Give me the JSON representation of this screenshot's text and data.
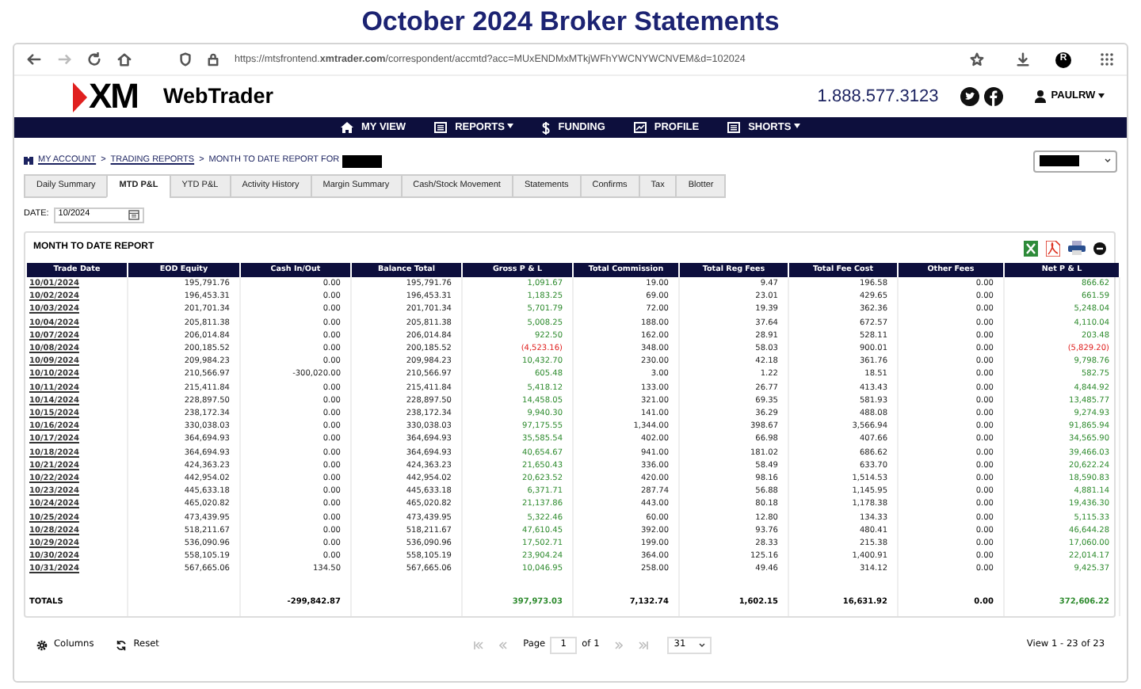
{
  "page_title": "October 2024 Broker Statements",
  "browser": {
    "url": "https://mtsfrontend.**xmtrader.com**/correspondent/accmtd?acc=MUxENDMxMTkjWFhYWCNYWCNVEM&d=102024",
    "profile_initial": "R"
  },
  "header": {
    "logo": "XM",
    "app_name": "WebTrader",
    "phone": "1.888.577.3123",
    "user": "PAULRW"
  },
  "nav": [
    {
      "label": "MY VIEW",
      "kind": "home",
      "has_menu": false
    },
    {
      "label": "REPORTS",
      "kind": "list",
      "has_menu": true
    },
    {
      "label": "FUNDING",
      "kind": "dollar",
      "has_menu": false
    },
    {
      "label": "PROFILE",
      "kind": "chart",
      "has_menu": false
    },
    {
      "label": "SHORTS",
      "kind": "list",
      "has_menu": true
    }
  ],
  "breadcrumb": [
    {
      "label": "MY ACCOUNT",
      "kind": "link"
    },
    {
      "label": ">",
      "kind": "separator"
    },
    {
      "label": "TRADING REPORTS",
      "kind": "link"
    },
    {
      "label": ">",
      "kind": "separator"
    },
    {
      "label": "MONTH TO DATE REPORT FOR",
      "kind": "text"
    }
  ],
  "tabs": [
    {
      "label": "Daily Summary",
      "selected": false
    },
    {
      "label": "MTD P&L",
      "selected": true
    },
    {
      "label": "YTD P&L",
      "selected": false
    },
    {
      "label": "Activity History",
      "selected": false
    },
    {
      "label": "Margin Summary",
      "selected": false
    },
    {
      "label": "Cash/Stock Movement",
      "selected": false
    },
    {
      "label": "Statements",
      "selected": false
    },
    {
      "label": "Confirms",
      "selected": false
    },
    {
      "label": "Tax",
      "selected": false
    },
    {
      "label": "Blotter",
      "selected": false
    }
  ],
  "date_field": {
    "label": "DATE:",
    "value": "10/2024"
  },
  "report": {
    "title": "MONTH TO DATE REPORT",
    "columns": [
      "Trade Date",
      "EOD Equity",
      "Cash In/Out",
      "Balance Total",
      "Gross P & L",
      "Total Commission",
      "Total Reg Fees",
      "Total Fee Cost",
      "Other Fees",
      "Net P & L"
    ],
    "rows": [
      {
        "date": "10/01/2024",
        "eod": "195,791.76",
        "cash": "0.00",
        "balance": "195,791.76",
        "gross": {
          "text": "1,091.67",
          "loss": false
        },
        "commission": "19.00",
        "reg": "9.47",
        "fee": "196.58",
        "other": "0.00",
        "net": {
          "text": "866.62",
          "loss": false
        }
      },
      {
        "date": "10/02/2024",
        "eod": "196,453.31",
        "cash": "0.00",
        "balance": "196,453.31",
        "gross": {
          "text": "1,183.25",
          "loss": false
        },
        "commission": "69.00",
        "reg": "23.01",
        "fee": "429.65",
        "other": "0.00",
        "net": {
          "text": "661.59",
          "loss": false
        }
      },
      {
        "date": "10/03/2024",
        "eod": "201,701.34",
        "cash": "0.00",
        "balance": "201,701.34",
        "gross": {
          "text": "5,701.79",
          "loss": false
        },
        "commission": "72.00",
        "reg": "19.39",
        "fee": "362.36",
        "other": "0.00",
        "net": {
          "text": "5,248.04",
          "loss": false
        }
      },
      {
        "date": "10/04/2024",
        "eod": "205,811.38",
        "cash": "0.00",
        "balance": "205,811.38",
        "gross": {
          "text": "5,008.25",
          "loss": false
        },
        "commission": "188.00",
        "reg": "37.64",
        "fee": "672.57",
        "other": "0.00",
        "net": {
          "text": "4,110.04",
          "loss": false
        }
      },
      {
        "date": "10/07/2024",
        "eod": "206,014.84",
        "cash": "0.00",
        "balance": "206,014.84",
        "gross": {
          "text": "922.50",
          "loss": false
        },
        "commission": "162.00",
        "reg": "28.91",
        "fee": "528.11",
        "other": "0.00",
        "net": {
          "text": "203.48",
          "loss": false
        }
      },
      {
        "date": "10/08/2024",
        "eod": "200,185.52",
        "cash": "0.00",
        "balance": "200,185.52",
        "gross": {
          "text": "(4,523.16)",
          "loss": true
        },
        "commission": "348.00",
        "reg": "58.03",
        "fee": "900.01",
        "other": "0.00",
        "net": {
          "text": "(5,829.20)",
          "loss": true
        }
      },
      {
        "date": "10/09/2024",
        "eod": "209,984.23",
        "cash": "0.00",
        "balance": "209,984.23",
        "gross": {
          "text": "10,432.70",
          "loss": false
        },
        "commission": "230.00",
        "reg": "42.18",
        "fee": "361.76",
        "other": "0.00",
        "net": {
          "text": "9,798.76",
          "loss": false
        }
      },
      {
        "date": "10/10/2024",
        "eod": "210,566.97",
        "cash": "-300,020.00",
        "balance": "210,566.97",
        "gross": {
          "text": "605.48",
          "loss": false
        },
        "commission": "3.00",
        "reg": "1.22",
        "fee": "18.51",
        "other": "0.00",
        "net": {
          "text": "582.75",
          "loss": false
        }
      },
      {
        "date": "10/11/2024",
        "eod": "215,411.84",
        "cash": "0.00",
        "balance": "215,411.84",
        "gross": {
          "text": "5,418.12",
          "loss": false
        },
        "commission": "133.00",
        "reg": "26.77",
        "fee": "413.43",
        "other": "0.00",
        "net": {
          "text": "4,844.92",
          "loss": false
        }
      },
      {
        "date": "10/14/2024",
        "eod": "228,897.50",
        "cash": "0.00",
        "balance": "228,897.50",
        "gross": {
          "text": "14,458.05",
          "loss": false
        },
        "commission": "321.00",
        "reg": "69.35",
        "fee": "581.93",
        "other": "0.00",
        "net": {
          "text": "13,485.77",
          "loss": false
        }
      },
      {
        "date": "10/15/2024",
        "eod": "238,172.34",
        "cash": "0.00",
        "balance": "238,172.34",
        "gross": {
          "text": "9,940.30",
          "loss": false
        },
        "commission": "141.00",
        "reg": "36.29",
        "fee": "488.08",
        "other": "0.00",
        "net": {
          "text": "9,274.93",
          "loss": false
        }
      },
      {
        "date": "10/16/2024",
        "eod": "330,038.03",
        "cash": "0.00",
        "balance": "330,038.03",
        "gross": {
          "text": "97,175.55",
          "loss": false
        },
        "commission": "1,344.00",
        "reg": "398.67",
        "fee": "3,566.94",
        "other": "0.00",
        "net": {
          "text": "91,865.94",
          "loss": false
        }
      },
      {
        "date": "10/17/2024",
        "eod": "364,694.93",
        "cash": "0.00",
        "balance": "364,694.93",
        "gross": {
          "text": "35,585.54",
          "loss": false
        },
        "commission": "402.00",
        "reg": "66.98",
        "fee": "407.66",
        "other": "0.00",
        "net": {
          "text": "34,565.90",
          "loss": false
        }
      },
      {
        "date": "10/18/2024",
        "eod": "364,694.93",
        "cash": "0.00",
        "balance": "364,694.93",
        "gross": {
          "text": "40,654.67",
          "loss": false
        },
        "commission": "941.00",
        "reg": "181.02",
        "fee": "686.62",
        "other": "0.00",
        "net": {
          "text": "39,466.03",
          "loss": false
        }
      },
      {
        "date": "10/21/2024",
        "eod": "424,363.23",
        "cash": "0.00",
        "balance": "424,363.23",
        "gross": {
          "text": "21,650.43",
          "loss": false
        },
        "commission": "336.00",
        "reg": "58.49",
        "fee": "633.70",
        "other": "0.00",
        "net": {
          "text": "20,622.24",
          "loss": false
        }
      },
      {
        "date": "10/22/2024",
        "eod": "442,954.02",
        "cash": "0.00",
        "balance": "442,954.02",
        "gross": {
          "text": "20,623.52",
          "loss": false
        },
        "commission": "420.00",
        "reg": "98.16",
        "fee": "1,514.53",
        "other": "0.00",
        "net": {
          "text": "18,590.83",
          "loss": false
        }
      },
      {
        "date": "10/23/2024",
        "eod": "445,633.18",
        "cash": "0.00",
        "balance": "445,633.18",
        "gross": {
          "text": "6,371.71",
          "loss": false
        },
        "commission": "287.74",
        "reg": "56.88",
        "fee": "1,145.95",
        "other": "0.00",
        "net": {
          "text": "4,881.14",
          "loss": false
        }
      },
      {
        "date": "10/24/2024",
        "eod": "465,020.82",
        "cash": "0.00",
        "balance": "465,020.82",
        "gross": {
          "text": "21,137.86",
          "loss": false
        },
        "commission": "443.00",
        "reg": "80.18",
        "fee": "1,178.38",
        "other": "0.00",
        "net": {
          "text": "19,436.30",
          "loss": false
        }
      },
      {
        "date": "10/25/2024",
        "eod": "473,439.95",
        "cash": "0.00",
        "balance": "473,439.95",
        "gross": {
          "text": "5,322.46",
          "loss": false
        },
        "commission": "60.00",
        "reg": "12.80",
        "fee": "134.33",
        "other": "0.00",
        "net": {
          "text": "5,115.33",
          "loss": false
        }
      },
      {
        "date": "10/28/2024",
        "eod": "518,211.67",
        "cash": "0.00",
        "balance": "518,211.67",
        "gross": {
          "text": "47,610.45",
          "loss": false
        },
        "commission": "392.00",
        "reg": "93.76",
        "fee": "480.41",
        "other": "0.00",
        "net": {
          "text": "46,644.28",
          "loss": false
        }
      },
      {
        "date": "10/29/2024",
        "eod": "536,090.96",
        "cash": "0.00",
        "balance": "536,090.96",
        "gross": {
          "text": "17,502.71",
          "loss": false
        },
        "commission": "199.00",
        "reg": "28.33",
        "fee": "215.38",
        "other": "0.00",
        "net": {
          "text": "17,060.00",
          "loss": false
        }
      },
      {
        "date": "10/30/2024",
        "eod": "558,105.19",
        "cash": "0.00",
        "balance": "558,105.19",
        "gross": {
          "text": "23,904.24",
          "loss": false
        },
        "commission": "364.00",
        "reg": "125.16",
        "fee": "1,400.91",
        "other": "0.00",
        "net": {
          "text": "22,014.17",
          "loss": false
        }
      },
      {
        "date": "10/31/2024",
        "eod": "567,665.06",
        "cash": "134.50",
        "balance": "567,665.06",
        "gross": {
          "text": "10,046.95",
          "loss": false
        },
        "commission": "258.00",
        "reg": "49.46",
        "fee": "314.12",
        "other": "0.00",
        "net": {
          "text": "9,425.37",
          "loss": false
        }
      }
    ],
    "totals": {
      "label": "TOTALS",
      "cash": "-299,842.87",
      "gross": "397,973.03",
      "commission": "7,132.74",
      "reg": "1,602.15",
      "fee": "16,631.92",
      "other": "0.00",
      "net": "372,606.22"
    }
  },
  "footer": {
    "columns_button": "Columns",
    "reset_button": "Reset",
    "page_label": "Page",
    "page_value": "1",
    "page_of": "of 1",
    "page_size": "31",
    "view_text": "View 1 - 23 of 23"
  }
}
